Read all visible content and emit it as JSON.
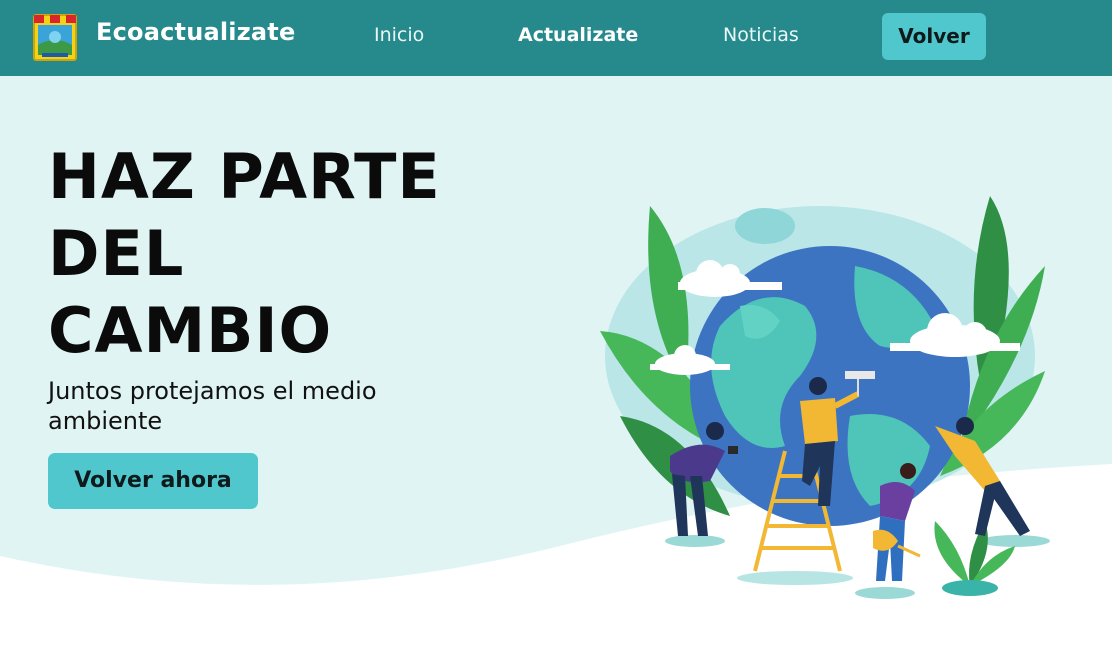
{
  "navbar": {
    "brand": "Ecoactualizate",
    "logo_icon": "municipal-shield-logo",
    "links": [
      {
        "label": "Inicio",
        "active": false
      },
      {
        "label": "Actualizate",
        "active": true
      },
      {
        "label": "Noticias",
        "active": false
      }
    ],
    "button_label": "Volver"
  },
  "hero": {
    "title_lines": [
      "HAZ PARTE",
      "DEL",
      "CAMBIO"
    ],
    "subtitle": "Juntos protejamos el medio ambiente",
    "cta_label": "Volver ahora",
    "illustration": "people-caring-for-earth-illustration"
  },
  "colors": {
    "navbar": "#268a8c",
    "accent": "#4fc7cc",
    "hero_background": "#e0f4f4",
    "text": "#0b0b0b"
  }
}
